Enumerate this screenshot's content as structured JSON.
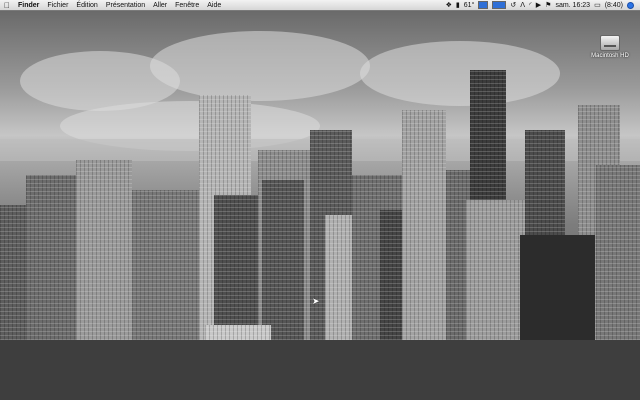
{
  "menubar": {
    "apple_icon": "apple-logo-icon",
    "items": [
      {
        "label": "Finder",
        "bold": true
      },
      {
        "label": "Fichier"
      },
      {
        "label": "Édition"
      },
      {
        "label": "Présentation"
      },
      {
        "label": "Aller"
      },
      {
        "label": "Fenêtre"
      },
      {
        "label": "Aide"
      }
    ],
    "status": {
      "temperature": "61°",
      "clock": "sam. 16:23",
      "battery": "(8:40)"
    }
  },
  "desktop": {
    "disk_label": "Macintosh HD"
  },
  "colors": {
    "menubar_top": "#f2f2f2",
    "menubar_bottom": "#d6d6d6",
    "spotlight_blue": "#2b74e6"
  }
}
